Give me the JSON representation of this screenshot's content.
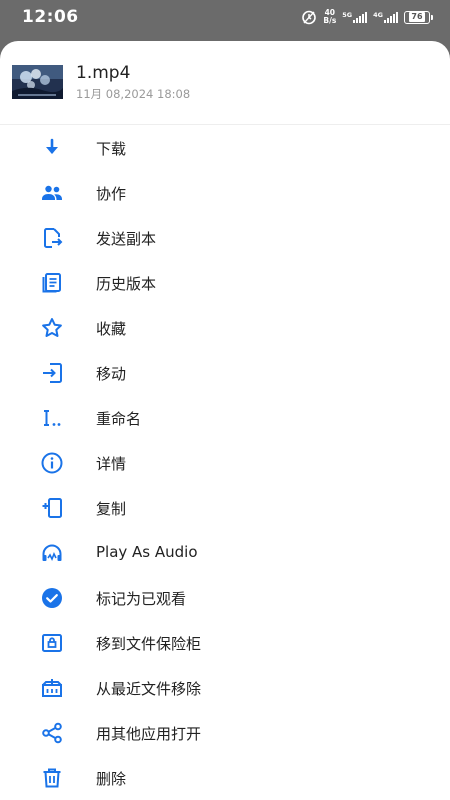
{
  "status_bar": {
    "time": "12:06",
    "net_speed_value": "40",
    "net_speed_unit": "B/s",
    "sim1_label": "5G",
    "sim2_label": "4G",
    "battery": "76"
  },
  "file": {
    "name": "1.mp4",
    "date": "11月 08,2024 18:08"
  },
  "menu": [
    {
      "label": "下载",
      "icon": "download-icon"
    },
    {
      "label": "协作",
      "icon": "people-icon"
    },
    {
      "label": "发送副本",
      "icon": "send-copy-icon"
    },
    {
      "label": "历史版本",
      "icon": "history-versions-icon"
    },
    {
      "label": "收藏",
      "icon": "star-icon"
    },
    {
      "label": "移动",
      "icon": "move-icon"
    },
    {
      "label": "重命名",
      "icon": "rename-icon"
    },
    {
      "label": "详情",
      "icon": "info-icon"
    },
    {
      "label": "复制",
      "icon": "copy-icon"
    },
    {
      "label": "Play As Audio",
      "icon": "headphones-icon"
    },
    {
      "label": "标记为已观看",
      "icon": "check-circle-icon"
    },
    {
      "label": "移到文件保险柜",
      "icon": "vault-icon"
    },
    {
      "label": "从最近文件移除",
      "icon": "remove-recent-icon"
    },
    {
      "label": "用其他应用打开",
      "icon": "share-icon"
    },
    {
      "label": "删除",
      "icon": "trash-icon"
    }
  ],
  "colors": {
    "accent": "#1a73e8",
    "overlay": "#6b6b6b",
    "sheet": "#ffffff"
  }
}
